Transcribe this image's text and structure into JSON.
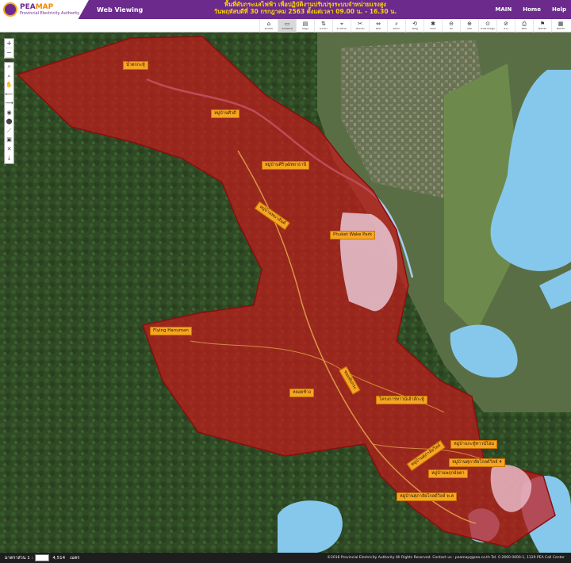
{
  "header": {
    "brand_name_a": "PEA",
    "brand_name_b": "MAP",
    "brand_sub": "Provincial Electricity Authority",
    "app_title": "Web Viewing",
    "notice_line1": "พื้นที่ดับกระแสไฟฟ้า เพื่อปฏิบัติงานปรับปรุงระบบจำหน่ายแรงสูง",
    "notice_line2": "วันพฤหัสบดีที่ 30 กรกฎาคม 2563 ตั้งแต่เวลา 09.00 น. - 16.30 น.",
    "nav": [
      "MAIN",
      "Home",
      "Help"
    ]
  },
  "toolbar": {
    "tools": [
      {
        "icon": "⌂",
        "label": "คงกลับ"
      },
      {
        "icon": "▭",
        "label": "ชั้นแผนที่"
      },
      {
        "icon": "▤",
        "label": "ข้อมูล"
      },
      {
        "icon": "⇅",
        "label": "นำเข้า"
      },
      {
        "icon": "⌖",
        "label": "ตำแหน่ง"
      },
      {
        "icon": "✂",
        "label": "วัดระยะ"
      },
      {
        "icon": "⇔",
        "label": "พิกัด"
      },
      {
        "icon": "⌕",
        "label": "ค้นหา"
      },
      {
        "icon": "⟲",
        "label": "ฟื้นฟู"
      },
      {
        "icon": "✱",
        "label": "เลือก"
      },
      {
        "icon": "⊖",
        "label": "ลบ"
      },
      {
        "icon": "⊕",
        "label": "เพิ่ม"
      },
      {
        "icon": "⊙",
        "label": "ค้นหาขั้นสูง"
      },
      {
        "icon": "⊘",
        "label": "ล้าง"
      },
      {
        "icon": "⎙",
        "label": "พิมพ์"
      },
      {
        "icon": "⚑",
        "label": "Buffer"
      },
      {
        "icon": "▦",
        "label": "Buffer"
      }
    ]
  },
  "map": {
    "outage_area_color": "#c41b1b",
    "water_color": "#86c8ec",
    "labels": [
      {
        "text": "น้ำตกกะทู้"
      },
      {
        "text": "หมู่บ้านศิวดี"
      },
      {
        "text": "หมู่บ้านศิริวุฒิทยาธานี"
      },
      {
        "text": "หมู่บ้านพนาสันต์"
      },
      {
        "text": "Phuket Wake Park"
      },
      {
        "text": "Flying Hanuman"
      },
      {
        "text": "ซอยทับกระ"
      },
      {
        "text": "หยอยช้าง"
      },
      {
        "text": "โครงการทาวน์เฮ้าส์กะทู้"
      },
      {
        "text": "หมู่บ้านกะทู้ทาวน์โฮม"
      },
      {
        "text": "หมู่บ้านศุภาลัยวิลล์"
      },
      {
        "text": "หมู่บ้านศุภาลัยโกลด์วิลล์ 4"
      },
      {
        "text": "หมู่บ้านพฤกษ์ลดา"
      },
      {
        "text": "หมู่บ้านศุภาลัยโกลด์วิลล์ พ.ค"
      }
    ]
  },
  "controls": {
    "zoom_in": "+",
    "zoom_out": "−",
    "side_tools": [
      "⌕",
      "⌕",
      "✋",
      "⟵",
      "⟶",
      "◉",
      "⬤",
      "⟋",
      "▣",
      "✕",
      "⤓"
    ]
  },
  "footer": {
    "scale_label": "มาตราส่วน 1 :",
    "scale_value": "4,514",
    "unit": "เมตร",
    "copyright": "©2018 Provincial Electricity Authority All Rights Reserved. Contact us : peamap@pea.co.th Tel. 0 2660 0000-1, 1129 PEA Call Center"
  }
}
